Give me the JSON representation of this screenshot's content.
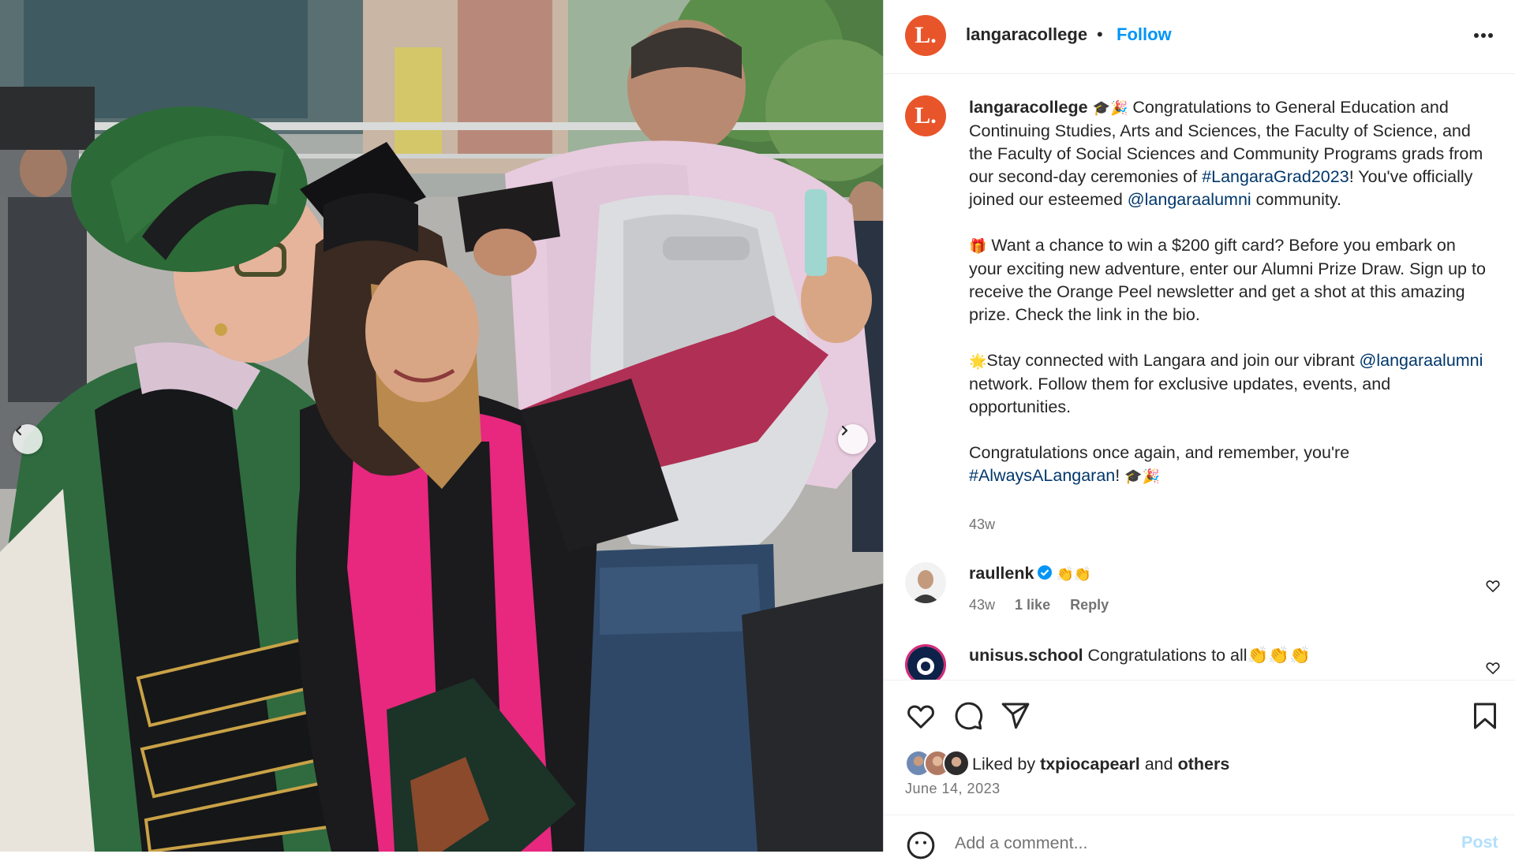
{
  "post": {
    "username": "langaracollege",
    "separator": "•",
    "follow_label": "Follow",
    "avatar_letter": "L.",
    "more_icon": "more-horizontal-icon",
    "brand_color": "#e8552a"
  },
  "caption": {
    "username": "langaracollege",
    "emoji_1": "🎓🎉",
    "line_1": " Congratulations to General Education and Continuing Studies, Arts and Sciences, the Faculty of Science, and the Faculty of Social Sciences and Community Programs grads from our second-day ceremonies of ",
    "hashtag_1": "#LangaraGrad2023",
    "line_1b": "! You've officially joined our esteemed ",
    "mention_1": "@langaraalumni",
    "line_1c": " community.",
    "emoji_2": "🎁",
    "para_2": " Want a chance to win a $200 gift card? Before you embark on your exciting new adventure, enter our Alumni Prize Draw. Sign up to receive the Orange Peel newsletter and get a shot at this amazing prize. Check the link in the bio.",
    "emoji_3": "🌟",
    "para_3a": "Stay connected with Langara and join our vibrant ",
    "mention_2": "@langaraalumni",
    "para_3b": " network. Follow them for exclusive updates, events, and opportunities.",
    "para_4a": "Congratulations once again, and remember, you're ",
    "hashtag_2": "#AlwaysALangaran",
    "para_4b": "! ",
    "emoji_4": "🎓🎉",
    "time": "43w"
  },
  "comments": [
    {
      "username": "raullenk",
      "verified": true,
      "text": "👏👏",
      "time": "43w",
      "likes": "1 like",
      "reply": "Reply"
    },
    {
      "username": "unisus.school",
      "verified": false,
      "text": "Congratulations to all👏👏👏"
    }
  ],
  "actions": {
    "like_icon": "heart-icon",
    "comment_icon": "comment-icon",
    "share_icon": "send-icon",
    "save_icon": "bookmark-icon"
  },
  "likes": {
    "prefix": "Liked by ",
    "user": "txpiocapearl",
    "middle": " and ",
    "others": "others"
  },
  "date": "June 14, 2023",
  "comment_box": {
    "placeholder": "Add a comment...",
    "post_label": "Post"
  },
  "colors": {
    "link": "#00376b",
    "follow": "#0095f6",
    "muted": "#737373"
  }
}
